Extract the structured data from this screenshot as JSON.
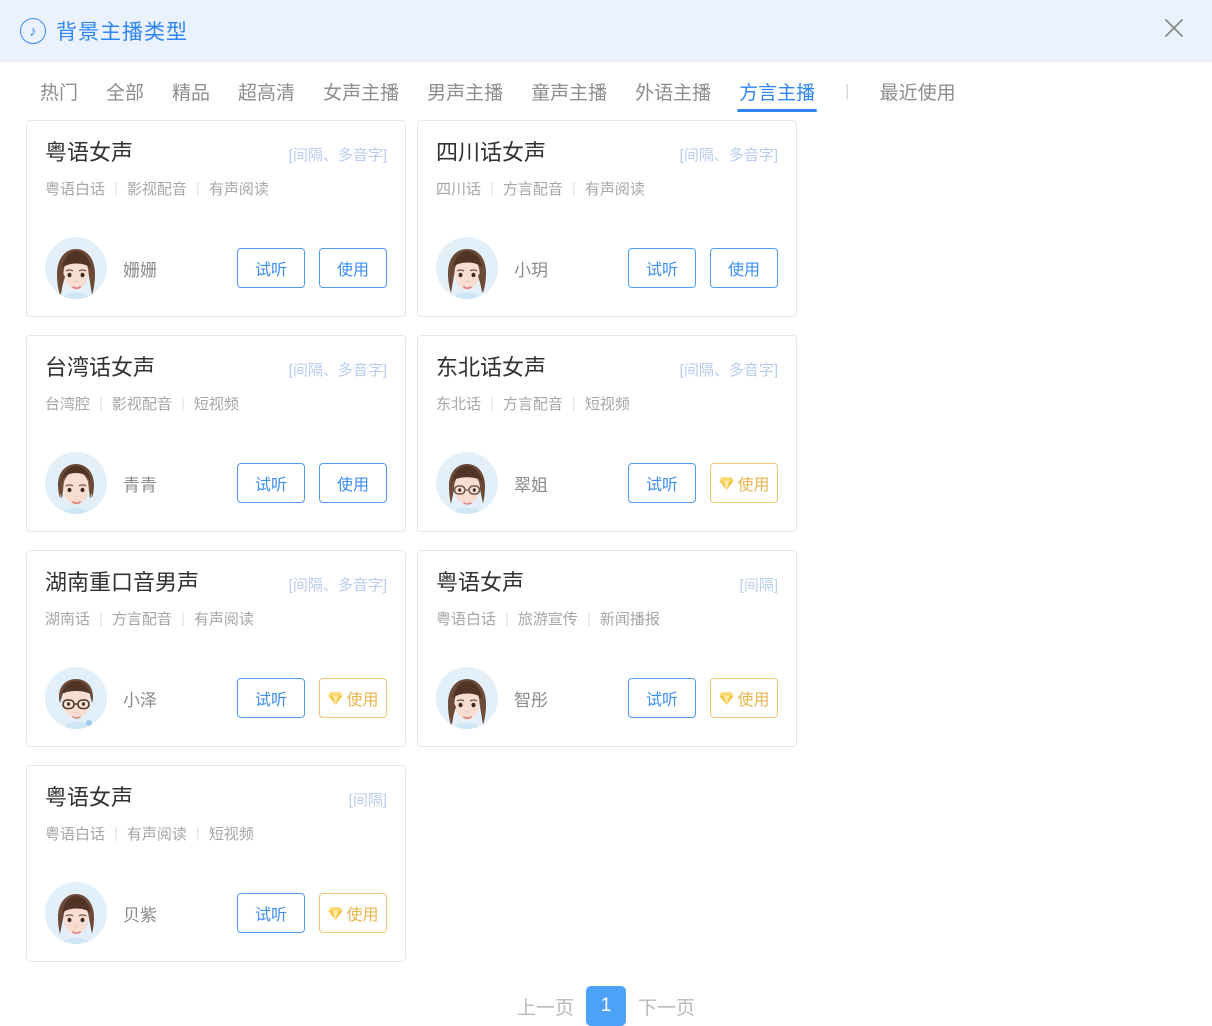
{
  "header": {
    "title": "背景主播类型",
    "icon": "music-note-icon",
    "close_icon": "close-icon",
    "accent_color": "#2f86f3",
    "background_color": "#eaf2fd"
  },
  "tabs": {
    "items": [
      {
        "label": "热门",
        "active": false
      },
      {
        "label": "全部",
        "active": false
      },
      {
        "label": "精品",
        "active": false
      },
      {
        "label": "超高清",
        "active": false
      },
      {
        "label": "女声主播",
        "active": false
      },
      {
        "label": "男声主播",
        "active": false
      },
      {
        "label": "童声主播",
        "active": false
      },
      {
        "label": "外语主播",
        "active": false
      },
      {
        "label": "方言主播",
        "active": true
      }
    ],
    "separator": "|",
    "recent_label": "最近使用"
  },
  "cards": [
    {
      "title": "粤语女声",
      "badge": "[间隔、多音字]",
      "tags": [
        "粤语白话",
        "影视配音",
        "有声阅读"
      ],
      "speaker": "姗姗",
      "avatar": "female-long-hair-avatar",
      "preview_label": "试听",
      "use_label": "使用",
      "vip": false
    },
    {
      "title": "四川话女声",
      "badge": "[间隔、多音字]",
      "tags": [
        "四川话",
        "方言配音",
        "有声阅读"
      ],
      "speaker": "小玥",
      "avatar": "female-wavy-hair-avatar",
      "preview_label": "试听",
      "use_label": "使用",
      "vip": false
    },
    {
      "title": "台湾话女声",
      "badge": "[间隔、多音字]",
      "tags": [
        "台湾腔",
        "影视配音",
        "短视频"
      ],
      "speaker": "青青",
      "avatar": "female-short-hair-avatar",
      "preview_label": "试听",
      "use_label": "使用",
      "vip": false
    },
    {
      "title": "东北话女声",
      "badge": "[间隔、多音字]",
      "tags": [
        "东北话",
        "方言配音",
        "短视频"
      ],
      "speaker": "翠姐",
      "avatar": "female-glasses-avatar",
      "preview_label": "试听",
      "use_label": "使用",
      "vip": true
    },
    {
      "title": "湖南重口音男声",
      "badge": "[间隔、多音字]",
      "tags": [
        "湖南话",
        "方言配音",
        "有声阅读"
      ],
      "speaker": "小泽",
      "avatar": "male-glasses-avatar",
      "preview_label": "试听",
      "use_label": "使用",
      "vip": true
    },
    {
      "title": "粤语女声",
      "badge": "[间隔]",
      "tags": [
        "粤语白话",
        "旅游宣传",
        "新闻播报"
      ],
      "speaker": "智彤",
      "avatar": "female-long-hair-avatar",
      "preview_label": "试听",
      "use_label": "使用",
      "vip": true
    },
    {
      "title": "粤语女声",
      "badge": "[间隔]",
      "tags": [
        "粤语白话",
        "有声阅读",
        "短视频"
      ],
      "speaker": "贝紫",
      "avatar": "female-bun-hair-avatar",
      "preview_label": "试听",
      "use_label": "使用",
      "vip": true
    }
  ],
  "pagination": {
    "prev_label": "上一页",
    "current_page": "1",
    "next_label": "下一页"
  },
  "colors": {
    "primary": "#2f86f3",
    "button_border": "#4e9cf5",
    "vip_gold": "#e9b44c",
    "badge": "#b9cdf2",
    "tag_text": "#a6a6a6"
  }
}
